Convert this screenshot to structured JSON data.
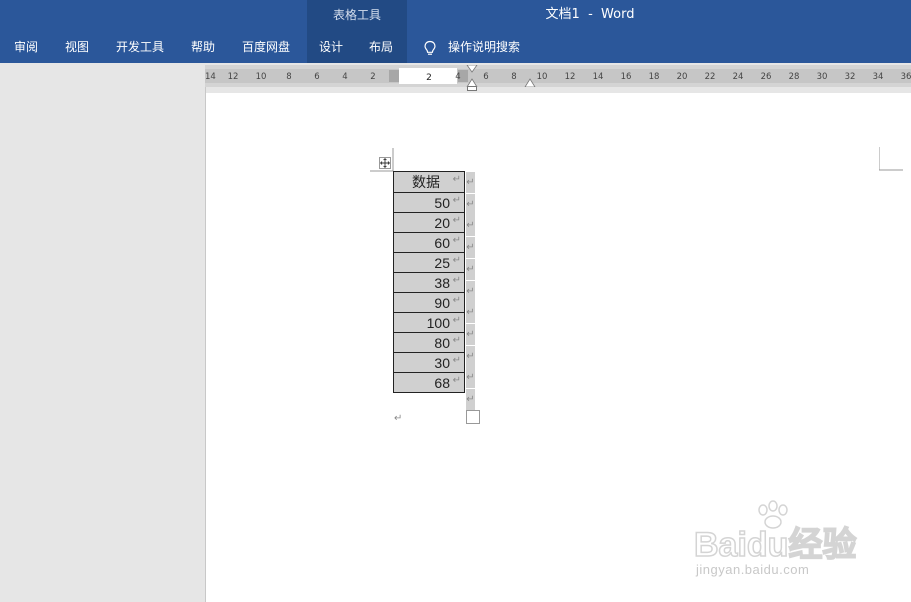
{
  "titlebar": {
    "context_group": "表格工具",
    "document_title": "文档1  -  Word"
  },
  "ribbon": {
    "tabs": [
      "审阅",
      "视图",
      "开发工具",
      "帮助",
      "百度网盘",
      "设计",
      "布局"
    ],
    "tell_me": "操作说明搜索"
  },
  "ruler": {
    "left_labels": [
      "14",
      "12",
      "10",
      "8",
      "6",
      "4",
      "2"
    ],
    "input_value": "2",
    "right_labels": [
      "4",
      "6",
      "8",
      "10",
      "12",
      "14",
      "16",
      "18",
      "20",
      "22",
      "24",
      "26",
      "28",
      "30",
      "32",
      "34",
      "36"
    ]
  },
  "table": {
    "header": "数据",
    "rows": [
      "50",
      "20",
      "60",
      "25",
      "38",
      "90",
      "100",
      "80",
      "30",
      "68"
    ]
  },
  "watermark": {
    "brand": "Baidu经验",
    "url": "jingyan.baidu.com"
  },
  "colors": {
    "ribbon_blue": "#2b579a",
    "context_blue": "#224a84",
    "cell_shade": "#d0d0d0"
  },
  "glyphs": {
    "paragraph_mark": "↵"
  }
}
